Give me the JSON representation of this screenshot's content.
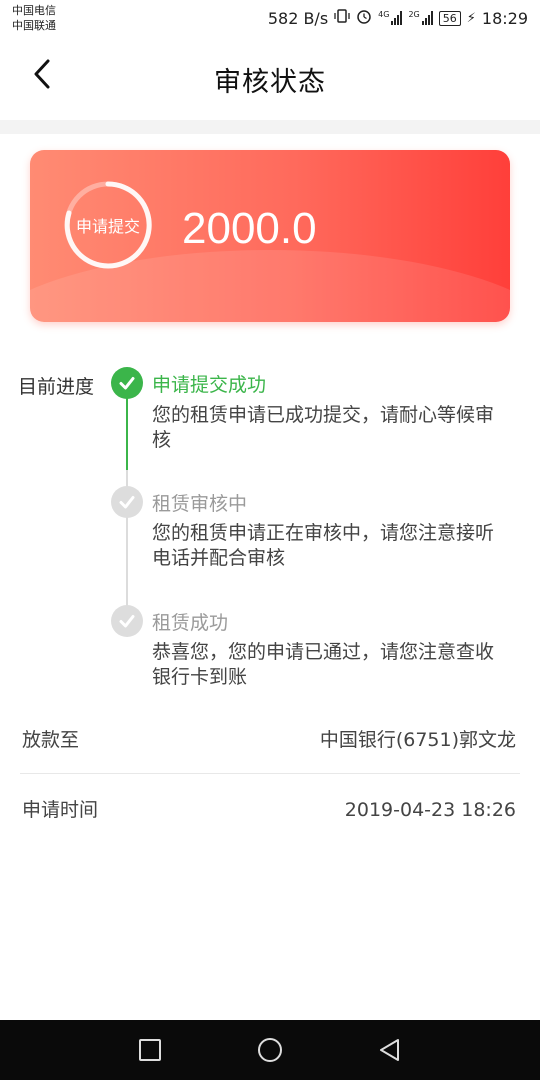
{
  "status_bar": {
    "carrier1": "中国电信",
    "carrier2": "中国联通",
    "net_speed": "582 B/s",
    "sig1_label": "4G",
    "sig2_label": "2G",
    "battery": "56",
    "time": "18:29"
  },
  "header": {
    "title": "审核状态",
    "back_icon": "chevron-left-icon"
  },
  "card": {
    "ring_label": "申请提交",
    "amount": "2000.0",
    "gradient_colors": [
      "#ff8b73",
      "#ff3f3a"
    ]
  },
  "progress": {
    "label": "目前进度",
    "steps": [
      {
        "title": "申请提交成功",
        "desc1": "您的租赁申请已成功提交，请耐心等候审",
        "desc2": "核",
        "state": "done"
      },
      {
        "title": "租赁审核中",
        "desc1": "您的租赁申请正在审核中，请您注意接听",
        "desc2": "电话并配合审核",
        "state": "pending"
      },
      {
        "title": "租赁成功",
        "desc1": "恭喜您，您的申请已通过，请您注意查收",
        "desc2": "银行卡到账",
        "state": "pending"
      }
    ],
    "colors": {
      "done": "#3bb54a",
      "pending": "#dddddd"
    }
  },
  "info": {
    "loan_to_label": "放款至",
    "loan_to_value": "中国银行(6751)郭文龙",
    "apply_time_label": "申请时间",
    "apply_time_value": "2019-04-23 18:26"
  },
  "nav": {
    "recent": "square-icon",
    "home": "circle-icon",
    "back": "triangle-back-icon"
  }
}
